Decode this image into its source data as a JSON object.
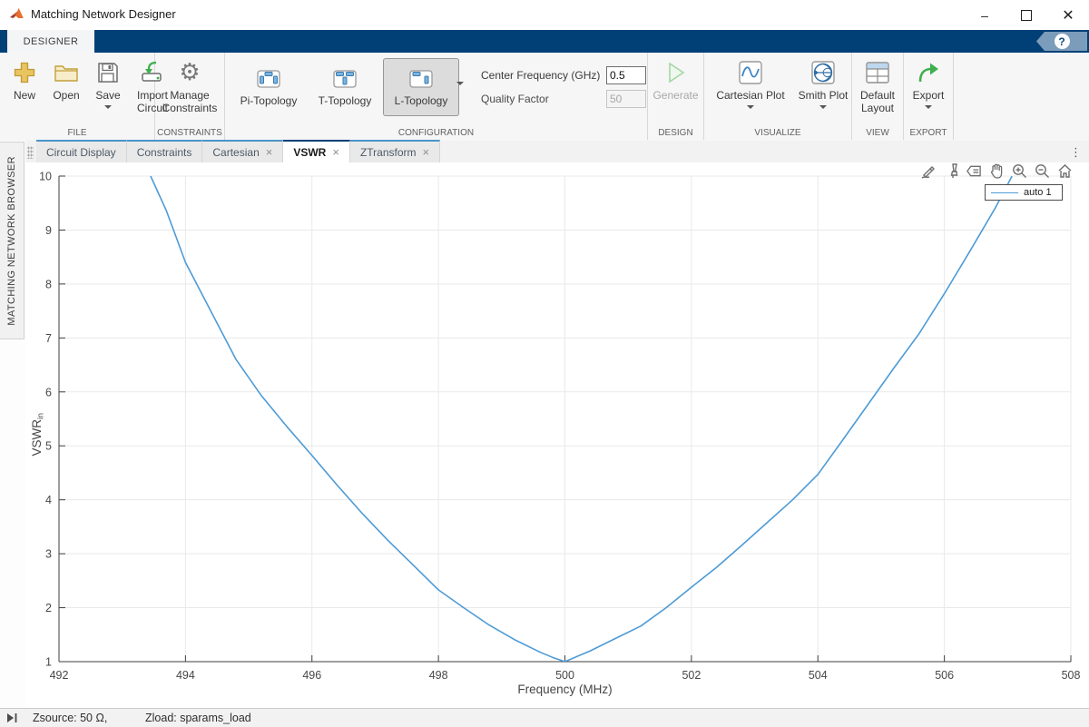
{
  "window": {
    "title": "Matching Network Designer",
    "controls": {
      "minimize": "–",
      "maximize": "",
      "close": "✕"
    }
  },
  "ribbon": {
    "tab_label": "DESIGNER",
    "help_glyph": "?"
  },
  "toolbar": {
    "file": {
      "label": "FILE",
      "new": "New",
      "open": "Open",
      "save": "Save",
      "import": "Import Circuit"
    },
    "constraints": {
      "label": "CONSTRAINTS",
      "manage": "Manage Constraints"
    },
    "config": {
      "label": "CONFIGURATION",
      "pi": "Pi-Topology",
      "t": "T-Topology",
      "l": "L-Topology",
      "selected_topology": "L-Topology",
      "center_freq_label": "Center Frequency (GHz)",
      "center_freq_value": "0.5",
      "quality_label": "Quality Factor",
      "quality_value": "50"
    },
    "design": {
      "label": "DESIGN",
      "generate": "Generate"
    },
    "visualize": {
      "label": "VISUALIZE",
      "cartesian": "Cartesian Plot",
      "smith": "Smith Plot"
    },
    "view": {
      "label": "VIEW",
      "default_layout": "Default Layout"
    },
    "export": {
      "label": "EXPORT",
      "export": "Export"
    }
  },
  "tabs": {
    "items": [
      {
        "label": "Circuit Display",
        "closable": false,
        "active": false
      },
      {
        "label": "Constraints",
        "closable": false,
        "active": false
      },
      {
        "label": "Cartesian",
        "closable": true,
        "active": false
      },
      {
        "label": "VSWR",
        "closable": true,
        "active": true
      },
      {
        "label": "ZTransform",
        "closable": true,
        "active": false
      }
    ]
  },
  "sidebar": {
    "title": "MATCHING NETWORK BROWSER"
  },
  "icons": {
    "close_tab": "×",
    "tab_overflow": "⋮",
    "gear": "⚙",
    "axes_toolbar": [
      "export",
      "brush",
      "data-tips",
      "pan",
      "zoom-in",
      "zoom-out",
      "restore-view"
    ]
  },
  "statusbar": {
    "zsource": "Zsource: 50 Ω,",
    "zload": "Zload: sparams_load"
  },
  "chart_data": {
    "type": "line",
    "title": "",
    "xlabel": "Frequency (MHz)",
    "ylabel": "VSWR",
    "ylabel_sub": "in",
    "xlim": [
      492,
      508
    ],
    "ylim": [
      1,
      10
    ],
    "xticks": [
      492,
      494,
      496,
      498,
      500,
      502,
      504,
      506,
      508
    ],
    "yticks": [
      1,
      2,
      3,
      4,
      5,
      6,
      7,
      8,
      9,
      10
    ],
    "grid": true,
    "legend": {
      "position": "northeast",
      "entries": [
        "auto 1"
      ]
    },
    "series": [
      {
        "name": "auto 1",
        "color": "#4d9bd6",
        "x": [
          493.45,
          493.7,
          494,
          494.4,
          494.8,
          495.2,
          495.6,
          496,
          496.4,
          496.8,
          497.2,
          497.6,
          498,
          498.4,
          498.8,
          499.2,
          499.6,
          499.8,
          500,
          500.4,
          500.8,
          501.2,
          501.6,
          502,
          502.4,
          502.8,
          503.2,
          503.6,
          504,
          504.4,
          504.8,
          505.2,
          505.6,
          506,
          506.4,
          506.8,
          507.07
        ],
        "y": [
          10,
          9.35,
          8.4,
          7.5,
          6.6,
          5.93,
          5.36,
          4.82,
          4.27,
          3.74,
          3.25,
          2.79,
          2.33,
          2.0,
          1.68,
          1.41,
          1.18,
          1.08,
          1.0,
          1.2,
          1.43,
          1.66,
          2.0,
          2.38,
          2.75,
          3.16,
          3.58,
          4.0,
          4.47,
          5.12,
          5.78,
          6.44,
          7.08,
          7.82,
          8.6,
          9.4,
          10
        ]
      }
    ]
  }
}
